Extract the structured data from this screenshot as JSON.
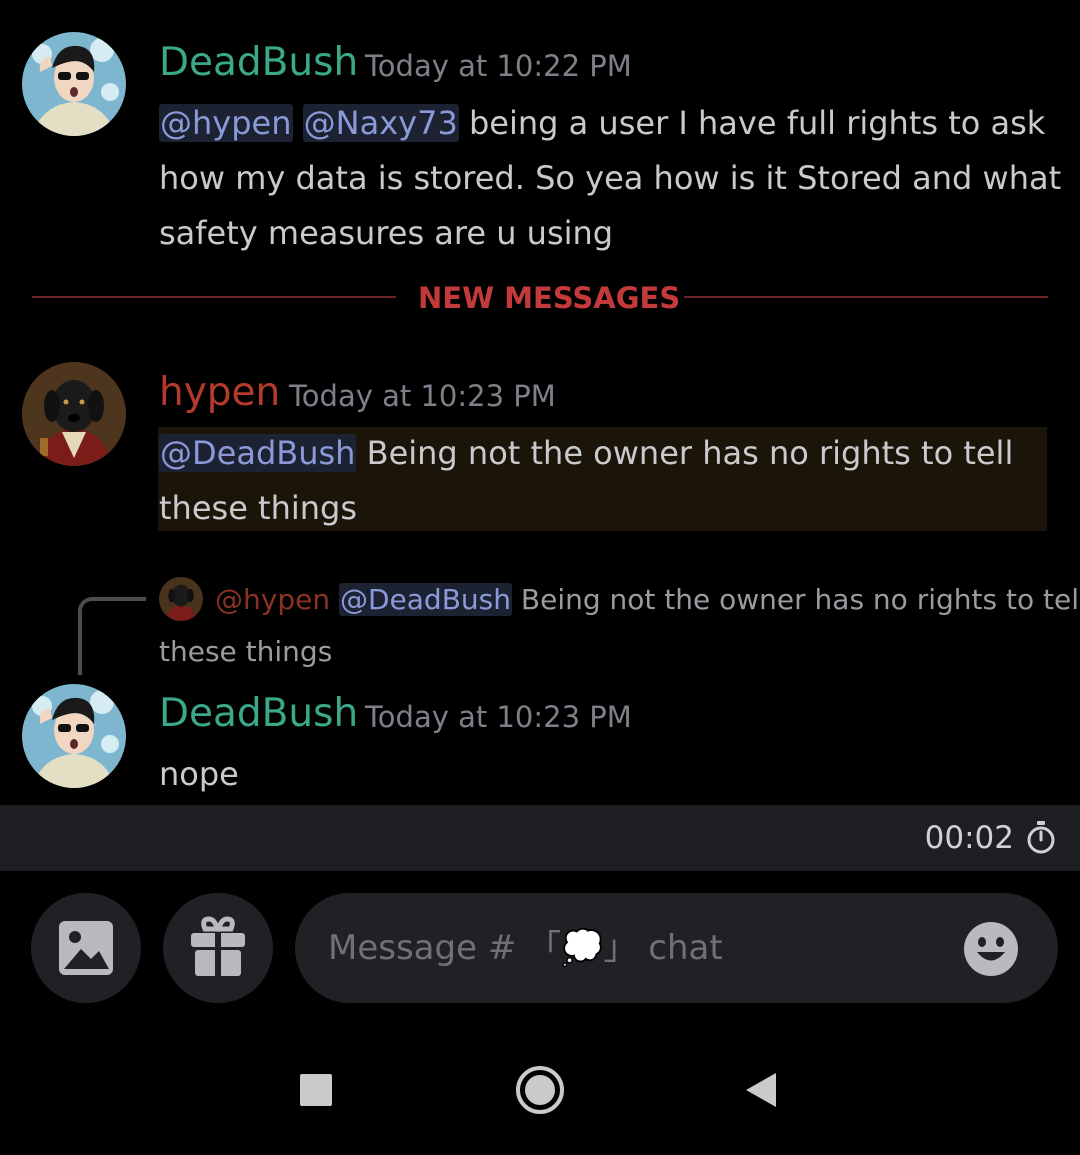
{
  "messages": [
    {
      "username": "DeadBush",
      "timestamp": "Today at 10:22 PM",
      "mention1": "@hypen",
      "mention2": "@Naxy73",
      "line1_rest": " being a user I have full rights to ask",
      "line2": "how my data is stored. So yea how is it Stored and what",
      "line3": "safety measures are u using"
    },
    {
      "username": "hypen",
      "timestamp": "Today at 10:23 PM",
      "mention": "@DeadBush",
      "line1_rest": " Being not the owner has no rights to tell",
      "line2": "these things"
    },
    {
      "reply_author": "@hypen",
      "reply_mention": "@DeadBush",
      "reply_line1_rest": " Being not the owner has no rights to tell",
      "reply_line2": "these things",
      "username": "DeadBush",
      "timestamp": "Today at 10:23 PM",
      "text": "nope"
    }
  ],
  "divider": {
    "label": "NEW MESSAGES"
  },
  "timer": {
    "value": "00:02",
    "icon": "stopwatch-icon"
  },
  "composer": {
    "placeholder_prefix": "Message # 「",
    "placeholder_emoji": "💭",
    "placeholder_suffix": "」 chat",
    "image_icon": "image-icon",
    "gift_icon": "gift-icon",
    "emoji_icon": "smiley-icon"
  },
  "colors": {
    "deadbush_name": "#3aa889",
    "hypen_name": "#b33a2c",
    "mention": "#8a9ad8",
    "divider": "#c23b3a"
  }
}
